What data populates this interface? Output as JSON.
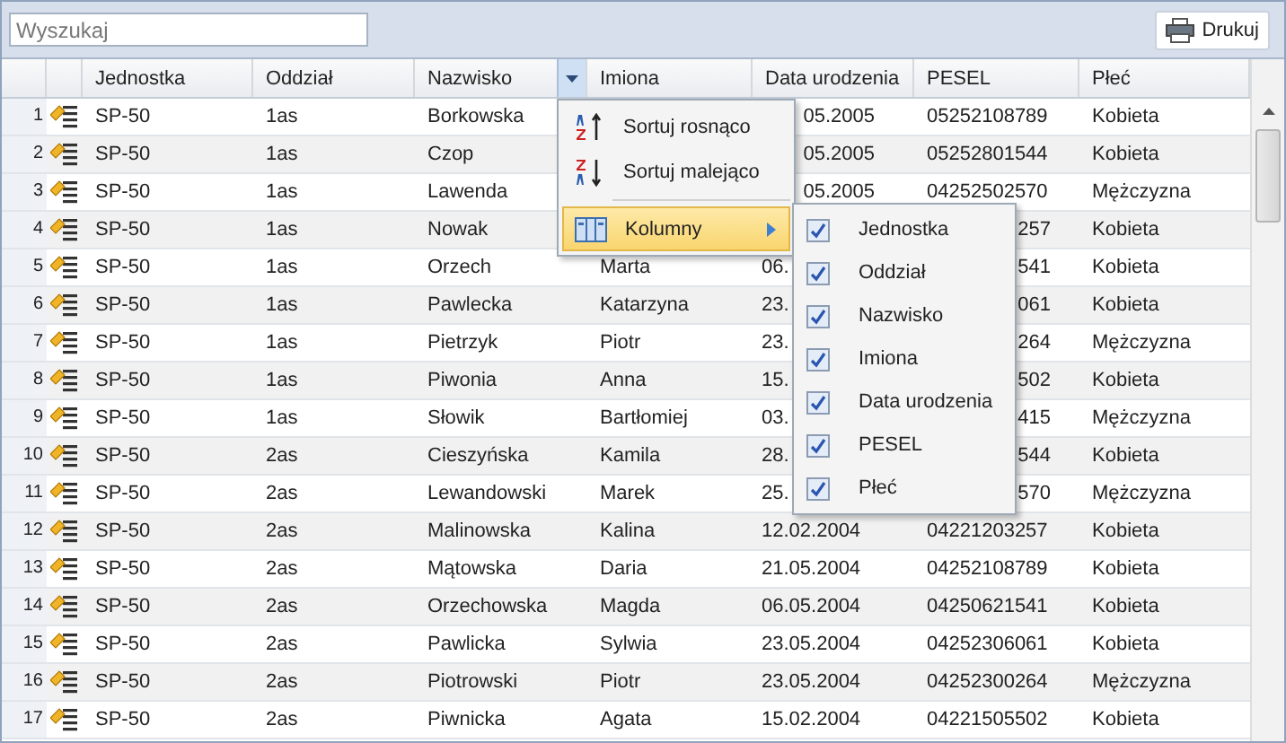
{
  "search": {
    "placeholder": "Wyszukaj"
  },
  "print_button": {
    "label": "Drukuj"
  },
  "table": {
    "columns": [
      {
        "label": "Jednostka",
        "menu_open": false
      },
      {
        "label": "Oddział",
        "menu_open": false
      },
      {
        "label": "Nazwisko",
        "menu_open": true
      },
      {
        "label": "Imiona",
        "menu_open": false
      },
      {
        "label": "Data urodzenia",
        "menu_open": false
      },
      {
        "label": "PESEL",
        "menu_open": false
      },
      {
        "label": "Płeć",
        "menu_open": false
      }
    ],
    "rows": [
      {
        "number": "1",
        "cells": [
          "SP-50",
          "1as",
          "Borkowska",
          null,
          {
            "text": "05.2005",
            "kind": "tail"
          },
          "05252108789",
          "Kobieta"
        ]
      },
      {
        "number": "2",
        "cells": [
          "SP-50",
          "1as",
          "Czop",
          null,
          {
            "text": "05.2005",
            "kind": "tail"
          },
          "05252801544",
          "Kobieta"
        ]
      },
      {
        "number": "3",
        "cells": [
          "SP-50",
          "1as",
          "Lawenda",
          null,
          {
            "text": "05.2005",
            "kind": "tail"
          },
          "04252502570",
          "Mężczyzna"
        ]
      },
      {
        "number": "4",
        "cells": [
          "SP-50",
          "1as",
          "Nowak",
          null,
          null,
          {
            "text": "257",
            "kind": "tail"
          },
          "Kobieta"
        ]
      },
      {
        "number": "5",
        "cells": [
          "SP-50",
          "1as",
          "Orzech",
          "Marta",
          "06.",
          {
            "text": "541",
            "kind": "tail"
          },
          "Kobieta"
        ]
      },
      {
        "number": "6",
        "cells": [
          "SP-50",
          "1as",
          "Pawlecka",
          "Katarzyna",
          "23.",
          {
            "text": "061",
            "kind": "tail"
          },
          "Kobieta"
        ]
      },
      {
        "number": "7",
        "cells": [
          "SP-50",
          "1as",
          "Pietrzyk",
          "Piotr",
          "23.",
          {
            "text": "264",
            "kind": "tail"
          },
          "Mężczyzna"
        ]
      },
      {
        "number": "8",
        "cells": [
          "SP-50",
          "1as",
          "Piwonia",
          "Anna",
          "15.",
          {
            "text": "502",
            "kind": "tail"
          },
          "Kobieta"
        ]
      },
      {
        "number": "9",
        "cells": [
          "SP-50",
          "1as",
          "Słowik",
          "Bartłomiej",
          "03.",
          {
            "text": "415",
            "kind": "tail"
          },
          "Mężczyzna"
        ]
      },
      {
        "number": "10",
        "cells": [
          "SP-50",
          "2as",
          "Cieszyńska",
          "Kamila",
          "28.",
          {
            "text": "544",
            "kind": "tail"
          },
          "Kobieta"
        ]
      },
      {
        "number": "11",
        "cells": [
          "SP-50",
          "2as",
          "Lewandowski",
          "Marek",
          "25.",
          {
            "text": "570",
            "kind": "tail"
          },
          "Mężczyzna"
        ]
      },
      {
        "number": "12",
        "cells": [
          "SP-50",
          "2as",
          "Malinowska",
          "Kalina",
          "12.02.2004",
          "04221203257",
          "Kobieta"
        ]
      },
      {
        "number": "13",
        "cells": [
          "SP-50",
          "2as",
          "Mątowska",
          "Daria",
          "21.05.2004",
          "04252108789",
          "Kobieta"
        ]
      },
      {
        "number": "14",
        "cells": [
          "SP-50",
          "2as",
          "Orzechowska",
          "Magda",
          "06.05.2004",
          "04250621541",
          "Kobieta"
        ]
      },
      {
        "number": "15",
        "cells": [
          "SP-50",
          "2as",
          "Pawlicka",
          "Sylwia",
          "23.05.2004",
          "04252306061",
          "Kobieta"
        ]
      },
      {
        "number": "16",
        "cells": [
          "SP-50",
          "2as",
          "Piotrowski",
          "Piotr",
          "23.05.2004",
          "04252300264",
          "Mężczyzna"
        ]
      },
      {
        "number": "17",
        "cells": [
          "SP-50",
          "2as",
          "Piwnicka",
          "Agata",
          "15.02.2004",
          "04221505502",
          "Kobieta"
        ]
      }
    ]
  },
  "context_menu": {
    "items": [
      {
        "kind": "sort_asc",
        "label": "Sortuj rosnąco",
        "selected": false
      },
      {
        "kind": "sort_desc",
        "label": "Sortuj malejąco",
        "selected": false
      },
      {
        "kind": "columns",
        "label": "Kolumny",
        "selected": true
      }
    ]
  },
  "columns_submenu": {
    "items": [
      {
        "label": "Jednostka",
        "checked": true
      },
      {
        "label": "Oddział",
        "checked": true
      },
      {
        "label": "Nazwisko",
        "checked": true
      },
      {
        "label": "Imiona",
        "checked": true
      },
      {
        "label": "Data urodzenia",
        "checked": true
      },
      {
        "label": "PESEL",
        "checked": true
      },
      {
        "label": "Płeć",
        "checked": true
      }
    ]
  }
}
